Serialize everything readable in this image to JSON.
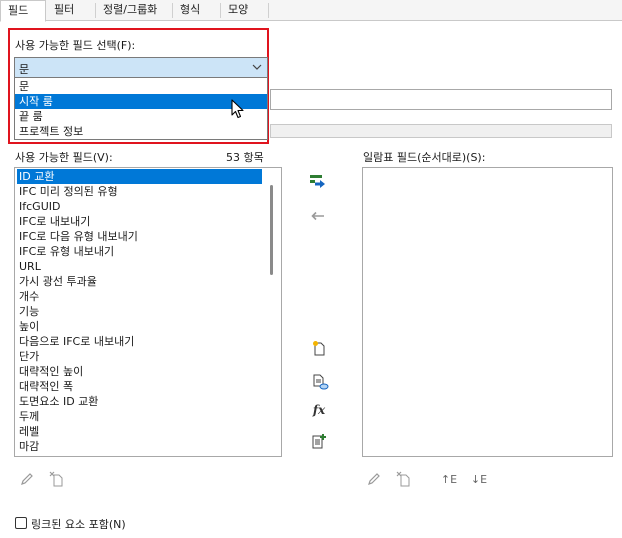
{
  "tabs": [
    "필드",
    "필터",
    "정렬/그룹화",
    "형식",
    "모양"
  ],
  "select_label": "사용 가능한 필드 선택(F):",
  "combo_value": "문",
  "dropdown_options": [
    "문",
    "시작 룸",
    "끝 룸",
    "프로젝트 정보"
  ],
  "dropdown_selected": "시작 룸",
  "available_label": "사용 가능한 필드(V):",
  "item_count": "53 항목",
  "schedule_label": "일람표 필드(순서대로)(S):",
  "available_fields": [
    "ID 교환",
    "IFC 미리 정의된 유형",
    "IfcGUID",
    "IFC로 내보내기",
    "IFC로 다음 유형 내보내기",
    "IFC로 유형 내보내기",
    "URL",
    "가시 광선 투과율",
    "개수",
    "기능",
    "높이",
    "다음으로 IFC로 내보내기",
    "단가",
    "대략적인 높이",
    "대략적인 폭",
    "도면요소 ID 교환",
    "두께",
    "레벨",
    "마감"
  ],
  "selected_field": "ID 교환",
  "include_linked_label": "링크된 요소 포함(N)",
  "include_linked_checked": false,
  "sort_up_label": "↑E",
  "sort_down_label": "↓E",
  "fx_label": "fx",
  "accent_color": "#0078d7",
  "highlight_color": "#e0141e"
}
